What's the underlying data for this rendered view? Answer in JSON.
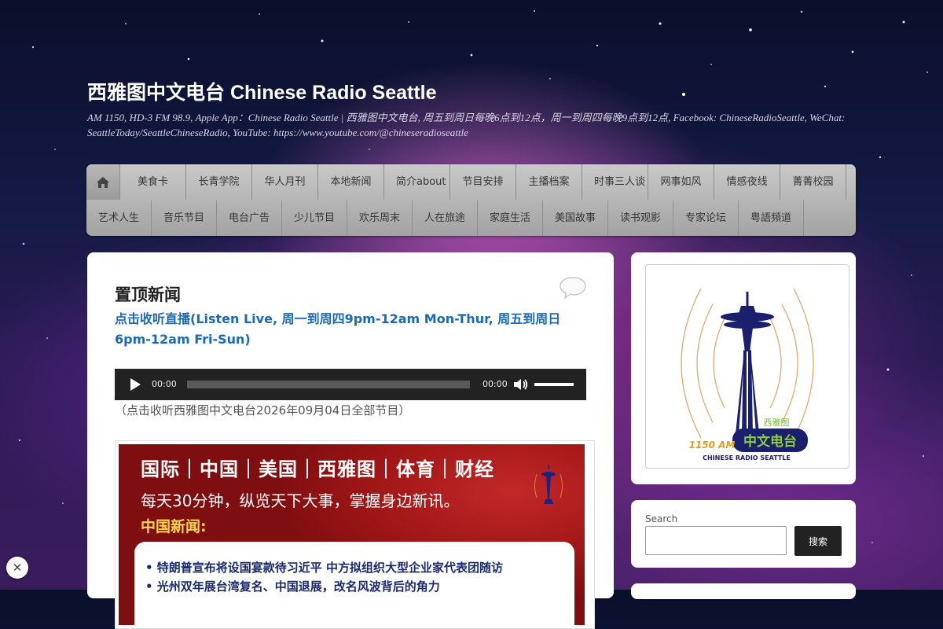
{
  "site": {
    "title": "西雅图中文电台 Chinese Radio Seattle",
    "description": "AM 1150, HD-3 FM 98.9, Apple App：Chinese Radio Seattle | 西雅图中文电台, 周五到周日每晚6点到12点，周一到周四每晚9点到12点, Facebook: ChineseRadioSeattle, WeChat: SeattleToday/SeattleChineseRadio, YouTube: https://www.youtube.com/@chineseradioseattle"
  },
  "nav": {
    "home_icon": "home-icon",
    "row1": [
      "美食卡",
      "长青学院",
      "华人月刊",
      "本地新闻",
      "简介about",
      "节目安排",
      "主播档案",
      "时事三人谈",
      "网事如风",
      "情感夜线",
      "菁菁校园"
    ],
    "row2": [
      "艺术人生",
      "音乐节目",
      "电台广告",
      "少儿节目",
      "欢乐周末",
      "人在旅途",
      "家庭生活",
      "美国故事",
      "读书观影",
      "专家论坛",
      "粤語頻道"
    ]
  },
  "post": {
    "title": "置顶新闻",
    "listen_link": "点击收听直播(Listen Live, 周一到周四9pm-12am Mon-Thur, 周五到周日6pm-12am Fri-Sun)",
    "player": {
      "current_time": "00:00",
      "duration": "00:00",
      "progress": 0,
      "volume": 1.0
    },
    "caption": "（点击收听西雅图中文电台2026年09月04日全部节目）",
    "banner": {
      "categories": "国际｜中国｜美国｜西雅图｜体育｜财经",
      "tagline": "每天30分钟，纵览天下大事，掌握身边新讯。",
      "section": "中国新闻:",
      "items": [
        "• 特朗普宣布将设国宴款待习近平 中方拟组织大型企业家代表团随访",
        "• 光州双年展台湾复名、中国退展，改名风波背后的角力"
      ]
    }
  },
  "sidebar": {
    "logo": {
      "am": "1150 AM",
      "city": "西雅图",
      "name": "中文电台",
      "english": "CHINESE RADIO SEATTLE"
    },
    "search": {
      "label": "Search",
      "placeholder": "",
      "button": "搜索"
    }
  },
  "colors": {
    "link": "#1b6ab5",
    "nav_bg": "#b5b5b5",
    "banner_red": "#a01616",
    "banner_yellow": "#ffd84a"
  },
  "widget": {
    "close_symbol": "✕"
  }
}
